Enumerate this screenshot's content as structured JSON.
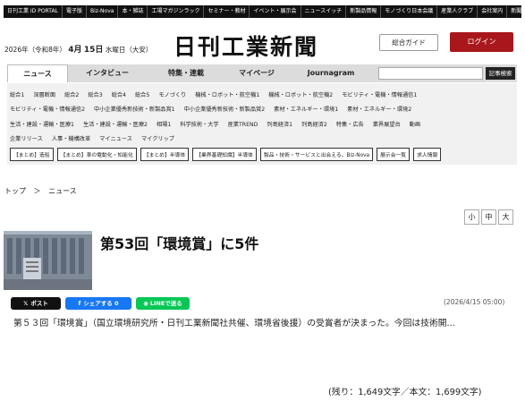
{
  "topbar": {
    "links": [
      "日刊工業 ID PORTAL",
      "電子版",
      "Biz-Nova",
      "本・雑誌",
      "工場マガジンラック",
      "セミナー・教材",
      "イベント・展示会",
      "ニュースイッチ",
      "新製品情報",
      "モノづくり日本会議",
      "産業人クラブ",
      "会社案内",
      "新聞購読・試読"
    ]
  },
  "header": {
    "date_prefix": "2026年（令和8年）",
    "month": "4月",
    "day": "15日",
    "weekday": "水曜日（大安）",
    "logo": "日刊工業新聞",
    "guide_button": "総合ガイド",
    "login_button": "ログイン"
  },
  "nav": {
    "tabs": [
      "ニュース",
      "インタビュー",
      "特集・連載",
      "マイページ",
      "Journagram"
    ],
    "search_button": "記事検索"
  },
  "categories": {
    "row1": [
      "総合1",
      "深層断面",
      "総合2",
      "総合3",
      "総合4",
      "総合5",
      "モノづくり",
      "機械・ロボット・航空機1",
      "機械・ロボット・航空機2",
      "モビリティ・電機・情報通信1"
    ],
    "row2": [
      "モビリティ・電機・情報通信2",
      "中小企業優秀新技術・新製品賞1",
      "中小企業優秀新技術・新製品賞2",
      "素材・エネルギー・環境1",
      "素材・エネルギー・環境2"
    ],
    "row3": [
      "生活・建設・運輸・医療1",
      "生活・建設・運輸・医療2",
      "相場1",
      "科学技術・大学",
      "産業TREND",
      "列島経済1",
      "列島経済2",
      "特集・広告",
      "業界展望台",
      "動画"
    ],
    "row4": [
      "企業リリース",
      "人事・機構改革",
      "マイニュース",
      "マイクリップ"
    ],
    "tags": [
      "【まとめ】造船",
      "【まとめ】車の電動化・知能化",
      "【まとめ】半導体",
      "【業界基礎知識】半導体",
      "製品・技術・サービスと出会える。Biz-Nova",
      "展示会一覧",
      "求人情報"
    ]
  },
  "breadcrumb": {
    "home": "トップ",
    "separator": "＞",
    "current": "ニュース"
  },
  "font_size": [
    "小",
    "中",
    "大"
  ],
  "article": {
    "title": "第53回「環境賞」に5件",
    "share_x": "ポスト",
    "share_fb": "シェアする 0",
    "share_line": "LINEで送る",
    "date": "(2026/4/15 05:00)",
    "body": "第５３回「環境賞」（国立環境研究所・日刊工業新聞社共催、環境省後援）の受賞者が決まった。今回は技術開...",
    "remaining": "(残り：1,649文字／本文：1,699文字)"
  },
  "colors": {
    "login": "#a8171b",
    "topbar": "#111111",
    "nav": "#dcdcdc",
    "facebook": "#1877f2",
    "line": "#06c755"
  }
}
